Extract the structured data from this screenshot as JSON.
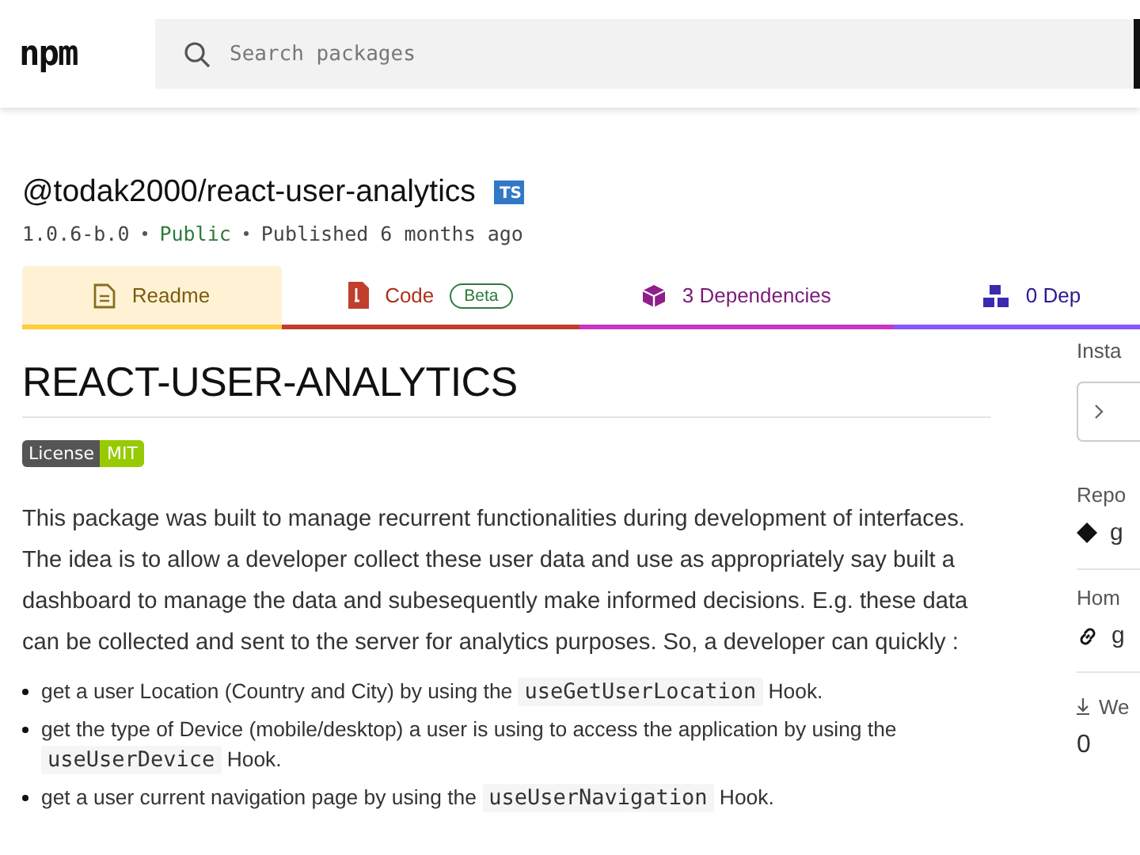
{
  "header": {
    "logo": "npm",
    "search": {
      "placeholder": "Search packages"
    }
  },
  "package": {
    "name": "@todak2000/react-user-analytics",
    "types_badge": "TS",
    "version": "1.0.6-b.0",
    "visibility": "Public",
    "published": "Published 6 months ago"
  },
  "tabs": [
    {
      "label": "Readme",
      "kind": "readme",
      "selected": true,
      "color": "#ffcd3a"
    },
    {
      "label": "Code",
      "kind": "code",
      "selected": false,
      "color": "#c13e2d",
      "badge": "Beta"
    },
    {
      "label": "3 Dependencies",
      "kind": "deps",
      "selected": false,
      "color": "#c836c3"
    },
    {
      "label": "0 Dep",
      "kind": "dependents",
      "selected": false,
      "color": "#8956ff"
    }
  ],
  "readme": {
    "heading": "REACT-USER-ANALYTICS",
    "license_badge": {
      "label": "License",
      "value": "MIT"
    },
    "paragraph": "This package was built to manage recurrent functionalities during development of interfaces. The idea is to allow a developer collect these user data and use as appropriately say built a dashboard to manage the data and subesequently make informed decisions. E.g. these data can be collected and sent to the server for analytics purposes. So, a developer can quickly :",
    "bullets": [
      [
        {
          "kind": "text",
          "text": "get a user Location (Country and City) by using the "
        },
        {
          "kind": "code",
          "text": "useGetUserLocation"
        },
        {
          "kind": "text",
          "text": " Hook."
        }
      ],
      [
        {
          "kind": "text",
          "text": "get the type of Device (mobile/desktop) a user is using to access the application by using the "
        },
        {
          "kind": "code",
          "text": "useUserDevice"
        },
        {
          "kind": "text",
          "text": " Hook."
        }
      ],
      [
        {
          "kind": "text",
          "text": "get a user current navigation page by using the "
        },
        {
          "kind": "code",
          "text": "useUserNavigation"
        },
        {
          "kind": "text",
          "text": " Hook."
        }
      ]
    ]
  },
  "sidebar": {
    "install_label": "Insta",
    "repo_label": "Repo",
    "repo_value": "g",
    "homepage_label": "Hom",
    "homepage_value": "g",
    "weekly_label": "We",
    "weekly_value": "0"
  }
}
